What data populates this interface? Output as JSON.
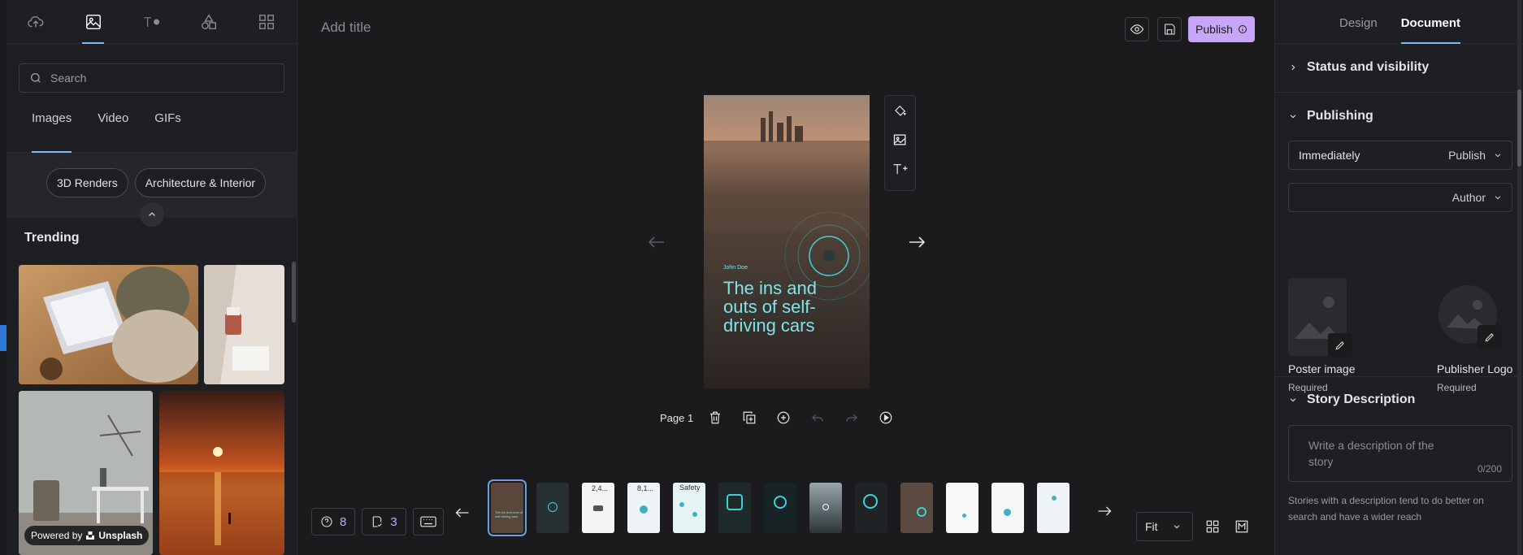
{
  "left_panel": {
    "tabs": [
      "upload",
      "media",
      "text",
      "shapes",
      "templates"
    ],
    "search_placeholder": "Search",
    "media_tabs": [
      "Images",
      "Video",
      "GIFs"
    ],
    "chips": [
      "3D Renders",
      "Architecture & Interior"
    ],
    "trending_title": "Trending",
    "powered_by": "Powered by",
    "powered_brand": "Unsplash"
  },
  "header": {
    "title_placeholder": "Add title",
    "publish_label": "Publish"
  },
  "canvas": {
    "author": "John Doe",
    "headline": "The ins and outs of self-driving cars",
    "page_label": "Page 1"
  },
  "bottom_bar": {
    "help_count": "8",
    "checklist_count": "3",
    "thumb_texts": [
      "",
      "",
      "2,4...",
      "8,1...",
      "Safety",
      "",
      "",
      "",
      "",
      "",
      "",
      "",
      ""
    ],
    "zoom_value": "Fit"
  },
  "right_panel": {
    "tabs": [
      "Design",
      "Document"
    ],
    "status_section": "Status and visibility",
    "publishing_section": "Publishing",
    "publish_time": "Immediately",
    "publish_action": "Publish",
    "author_label": "Author",
    "poster_label": "Poster image",
    "poster_sub": "Required",
    "logo_label": "Publisher Logo",
    "logo_sub": "Required",
    "description_section": "Story Description",
    "description_placeholder": "Write a description of the story",
    "description_count": "0/200",
    "description_help": "Stories with a description tend to do better on search and have a wider reach"
  },
  "colors": {
    "accent": "#c8a6f7",
    "tab_underline": "#7fb7ff",
    "teal_text": "#7fe3ea"
  }
}
